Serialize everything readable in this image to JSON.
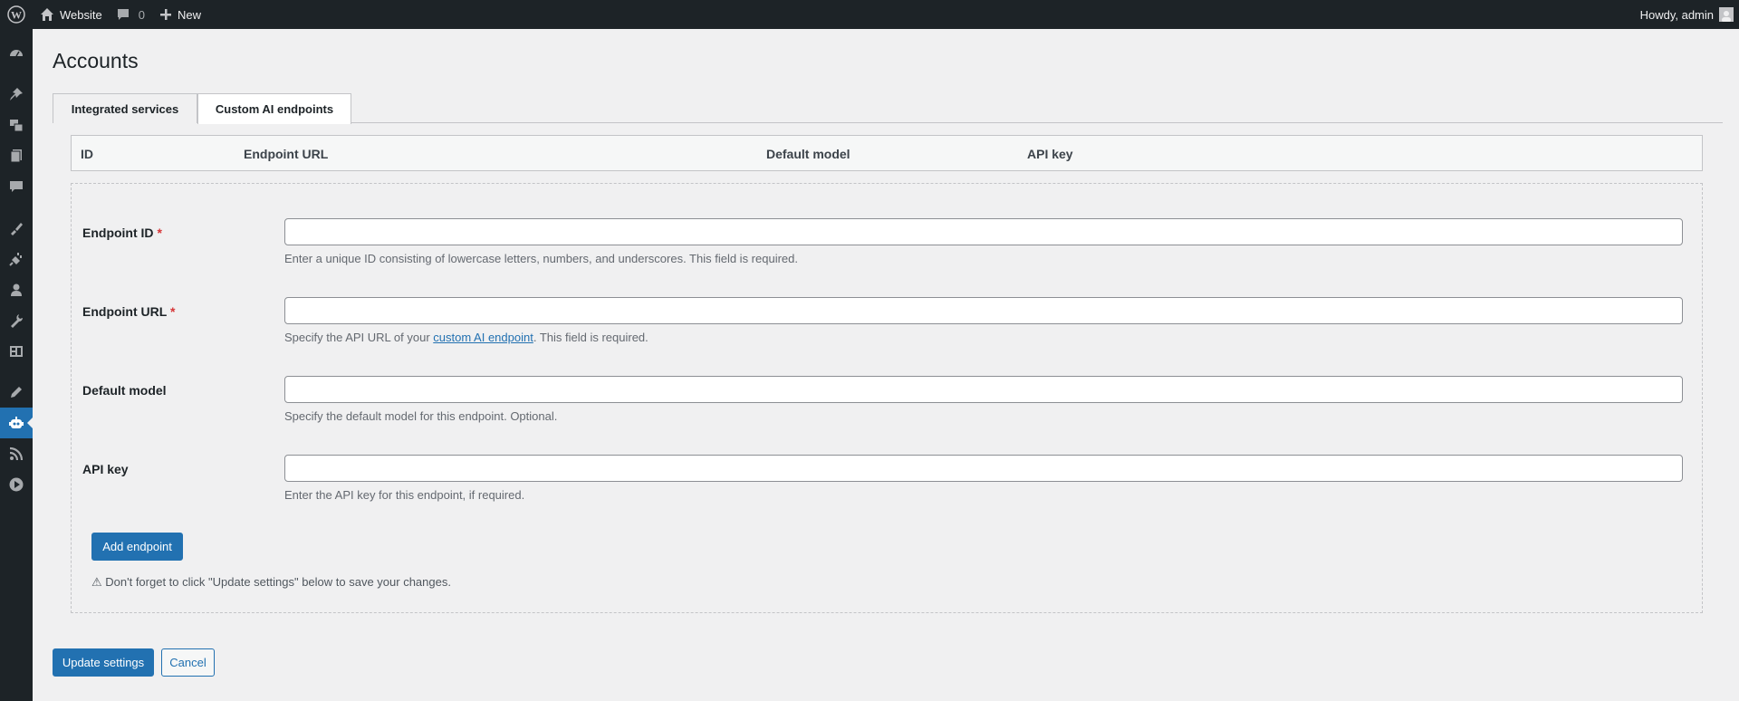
{
  "adminbar": {
    "site_name": "Website",
    "comments_count": "0",
    "new_label": "New",
    "howdy": "Howdy, admin"
  },
  "sidebar": {
    "icons": [
      "dashboard-icon",
      "pin-icon",
      "media-icon",
      "pages-icon",
      "comments-icon",
      "appearance-icon",
      "plugins-icon",
      "users-icon",
      "tools-icon",
      "settings-icon",
      "pen-icon",
      "ai-robot-icon",
      "rss-icon",
      "play-icon"
    ],
    "active_index": 11
  },
  "page": {
    "title": "Accounts"
  },
  "tabs": [
    {
      "label": "Integrated services",
      "active": false
    },
    {
      "label": "Custom AI endpoints",
      "active": true
    }
  ],
  "table": {
    "headers": [
      "ID",
      "Endpoint URL",
      "Default model",
      "API key"
    ]
  },
  "form": {
    "fields": [
      {
        "label": "Endpoint ID",
        "required": true,
        "value": "",
        "desc": "Enter a unique ID consisting of lowercase letters, numbers, and underscores. This field is required."
      },
      {
        "label": "Endpoint URL",
        "required": true,
        "value": "",
        "desc_prefix": "Specify the API URL of your ",
        "desc_link": "custom AI endpoint",
        "desc_suffix": ". This field is required."
      },
      {
        "label": "Default model",
        "required": false,
        "value": "",
        "desc": "Specify the default model for this endpoint. Optional."
      },
      {
        "label": "API key",
        "required": false,
        "value": "",
        "desc": "Enter the API key for this endpoint, if required."
      }
    ],
    "required_marker": "*",
    "add_button": "Add endpoint",
    "warning": "⚠ Don't forget to click \"Update settings\" below to save your changes."
  },
  "actions": {
    "update": "Update settings",
    "cancel": "Cancel"
  },
  "colors": {
    "primary": "#2271b1",
    "adminbar": "#1d2327",
    "required": "#d63638"
  }
}
